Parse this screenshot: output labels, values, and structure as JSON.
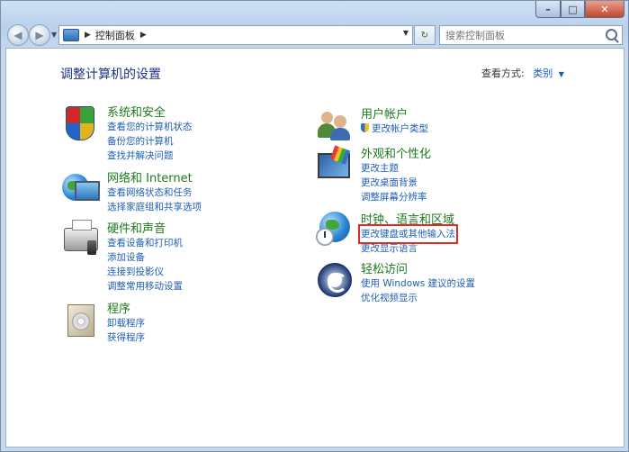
{
  "window": {
    "controls": {
      "minimize": "–",
      "maximize": "□",
      "close": "✕"
    }
  },
  "nav": {
    "back_icon": "◀",
    "forward_icon": "▶",
    "breadcrumb": [
      "控制面板"
    ],
    "search_placeholder": "搜索控制面板",
    "refresh_icon": "↻"
  },
  "content": {
    "title": "调整计算机的设置",
    "view_by_label": "查看方式:",
    "view_by_value": "类别",
    "left_categories": [
      {
        "title": "系统和安全",
        "icon": "shield-icon",
        "links": [
          "查看您的计算机状态",
          "备份您的计算机",
          "查找并解决问题"
        ]
      },
      {
        "title": "网络和 Internet",
        "icon": "network-icon",
        "links": [
          "查看网络状态和任务",
          "选择家庭组和共享选项"
        ]
      },
      {
        "title": "硬件和声音",
        "icon": "printer-icon",
        "links": [
          "查看设备和打印机",
          "添加设备",
          "连接到投影仪",
          "调整常用移动设置"
        ]
      },
      {
        "title": "程序",
        "icon": "programs-icon",
        "links": [
          "卸载程序",
          "获得程序"
        ]
      }
    ],
    "right_categories": [
      {
        "title": "用户帐户",
        "icon": "users-icon",
        "links": [
          "更改帐户类型"
        ]
      },
      {
        "title": "外观和个性化",
        "icon": "display-icon",
        "links": [
          "更改主题",
          "更改桌面背景",
          "调整屏幕分辨率"
        ]
      },
      {
        "title": "时钟、语言和区域",
        "icon": "clock-globe-icon",
        "links": [
          "更改键盘或其他输入法",
          "更改显示语言"
        ],
        "highlighted_link_index": 0
      },
      {
        "title": "轻松访问",
        "icon": "accessibility-icon",
        "links": [
          "使用 Windows 建议的设置",
          "优化视频显示"
        ]
      }
    ]
  },
  "colors": {
    "title": "#1e3287",
    "category": "#1e7a1e",
    "link": "#1f5fb4",
    "highlight_box": "#e02a2a"
  }
}
